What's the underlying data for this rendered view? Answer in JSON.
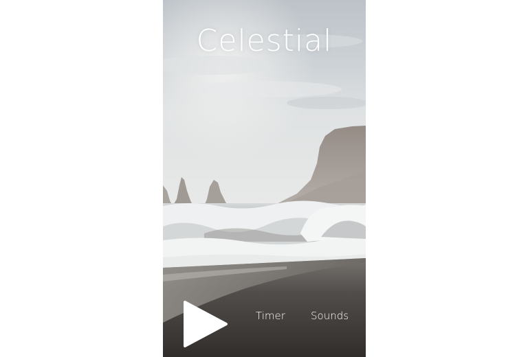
{
  "app": {
    "title": "Celestial"
  },
  "controls": {
    "play_icon": "play-icon",
    "timer_label": "Timer",
    "sounds_label": "Sounds"
  },
  "background": {
    "scene": "stormy-beach-with-sea-stacks",
    "colors": {
      "sky": "#c9ced3",
      "cliff": "#8d8580",
      "foam": "#eef0f1",
      "sand": "#3f3b39"
    }
  }
}
